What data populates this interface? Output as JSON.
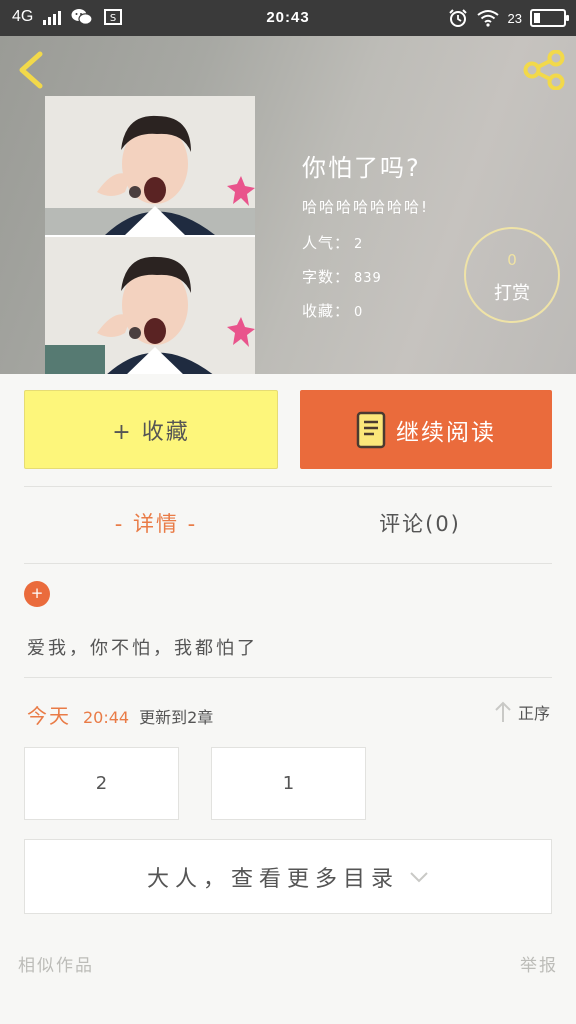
{
  "status_bar": {
    "network": "4G",
    "time": "20:43",
    "battery_percent": "23"
  },
  "book": {
    "title": "你怕了吗?",
    "subtitle": "哈哈哈哈哈哈哈!",
    "popularity_label": "人气：",
    "popularity": "2",
    "word_count_label": "字数：",
    "word_count": "839",
    "favorites_label": "收藏：",
    "favorites": "0"
  },
  "tip": {
    "count": "0",
    "label": "打赏"
  },
  "actions": {
    "favorite_label": "+ 收藏",
    "continue_label": "继续阅读"
  },
  "tabs": {
    "detail": "- 详情 -",
    "comments": "评论(0)"
  },
  "tag": {
    "symbol": "+"
  },
  "description": "爱我，你不怕，我都怕了",
  "update": {
    "day": "今天",
    "time": "20:44",
    "text": "更新到2章",
    "order_label": "正序"
  },
  "chapters": [
    "2",
    "1"
  ],
  "more_catalog_label": "大人，查看更多目录",
  "footer": {
    "similar": "相似作品",
    "report": "举报"
  },
  "colors": {
    "accent": "#ea6b3c",
    "favorite_bg": "#fdf67b",
    "highlight_text": "#e97b46"
  }
}
